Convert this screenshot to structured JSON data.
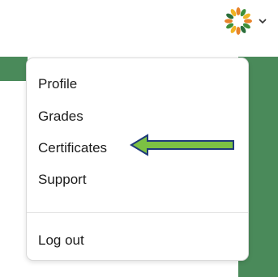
{
  "header": {
    "avatar_icon": "colorful-leaf-logo-avatar",
    "chevron_icon": "chevron-down-icon"
  },
  "menu": {
    "items": [
      {
        "label": "Profile"
      },
      {
        "label": "Grades"
      },
      {
        "label": "Certificates"
      },
      {
        "label": "Support"
      },
      {
        "label": "Log out"
      }
    ]
  },
  "annotation": {
    "arrow_icon": "left-arrow-icon",
    "arrow_color": "#7cc143",
    "arrow_outline": "#1f3a7a"
  },
  "colors": {
    "background_accent": "#4a8a5a",
    "menu_border": "#dadada",
    "text": "#1b1b1b"
  }
}
